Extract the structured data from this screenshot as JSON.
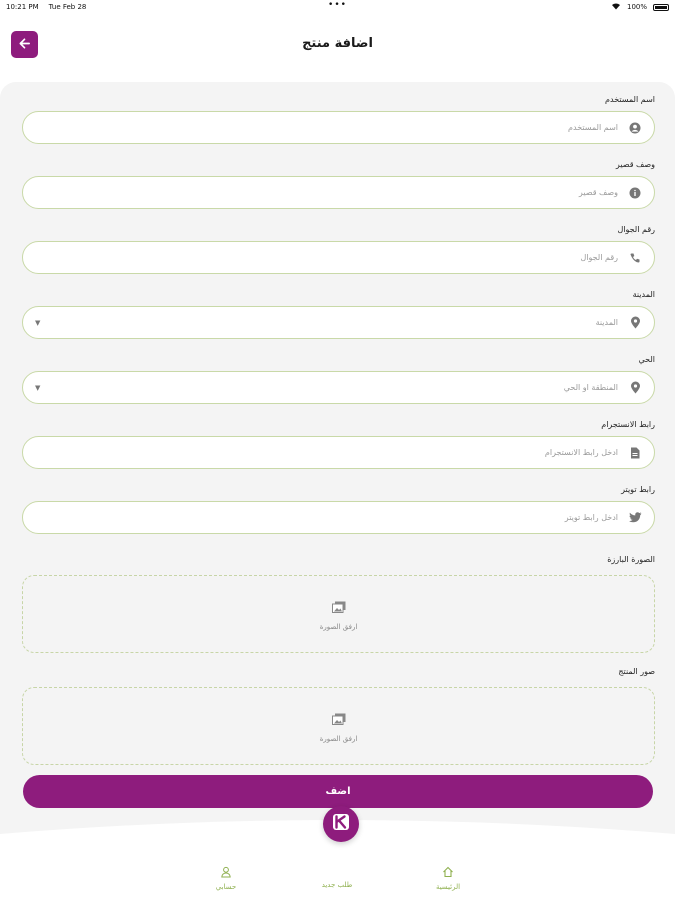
{
  "status": {
    "time": "10:21 PM",
    "date": "Tue Feb 28",
    "dots": "•••",
    "battery": "100%"
  },
  "header": {
    "title": "اضافة منتج"
  },
  "fields": [
    {
      "label": "اسم المستخدم",
      "placeholder": "اسم المستخدم",
      "icon": "user-icon"
    },
    {
      "label": "وصف قصير",
      "placeholder": "وصف قصير",
      "icon": "info-icon"
    },
    {
      "label": "رقم الجوال",
      "placeholder": "رقم الجوال",
      "icon": "phone-icon"
    },
    {
      "label": "المدينة",
      "placeholder": "المدينة",
      "icon": "location-icon"
    },
    {
      "label": "الحي",
      "placeholder": "المنطقة او الحي",
      "icon": "location-icon"
    },
    {
      "label": "رابط الانستجرام",
      "placeholder": "ادخل رابط الانستجرام",
      "icon": "document-icon"
    },
    {
      "label": "رابط تويتر",
      "placeholder": "ادخل رابط تويتر",
      "icon": "twitter-icon"
    }
  ],
  "uploads": [
    {
      "label": "الصورة البارزة",
      "button": "ارفق الصورة",
      "icon": "image-gallery-icon"
    },
    {
      "label": "صور المنتج",
      "button": "ارفق الصورة",
      "icon": "image-gallery-icon"
    }
  ],
  "submit": {
    "label": "اضف"
  },
  "nav": {
    "home": "الرئيسية",
    "new_order": "طلب جديد",
    "account": "حسابي"
  },
  "colors": {
    "brand": "#8e1c7d",
    "field_border": "#c9d9a8",
    "nav_accent": "#8fb04f"
  }
}
